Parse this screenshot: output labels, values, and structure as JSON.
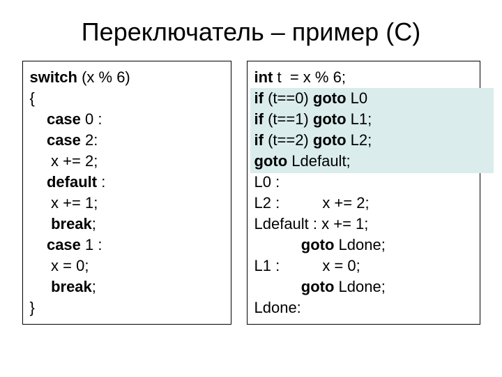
{
  "title": "Переключатель – пример (C)",
  "left": {
    "l1a": "switch",
    "l1b": " (x % 6)",
    "l2": "{",
    "l3a": "    ",
    "l3b": "case",
    "l3c": " 0 :",
    "l4a": "    ",
    "l4b": "case",
    "l4c": " 2:",
    "l5": "     x += 2;",
    "l6a": "    ",
    "l6b": "default",
    "l6c": " :",
    "l7": "     x += 1;",
    "l8a": "     ",
    "l8b": "break",
    "l8c": ";",
    "l9a": "    ",
    "l9b": "case",
    "l9c": " 1 :",
    "l10": "     x = 0;",
    "l11a": "     ",
    "l11b": "break",
    "l11c": ";",
    "l12": "}"
  },
  "right": {
    "l1a": "int",
    "l1b": " t  = x % 6;",
    "l2a": "if",
    "l2b": " (t==0) ",
    "l2c": "goto",
    "l2d": " L0",
    "l3a": "if",
    "l3b": " (t==1) ",
    "l3c": "goto",
    "l3d": " L1;",
    "l4a": "if",
    "l4b": " (t==2) ",
    "l4c": "goto",
    "l4d": " L2;",
    "l5a": "goto",
    "l5b": " Ldefault;",
    "l6": "L0 :",
    "l7": "L2 :          x += 2;",
    "l8": "Ldefault : x += 1;",
    "l9a": "           ",
    "l9b": "goto",
    "l9c": " Ldone;",
    "l10": "L1 :          x = 0;",
    "l11a": "           ",
    "l11b": "goto",
    "l11c": " Ldone;",
    "l12": "Ldone:"
  }
}
